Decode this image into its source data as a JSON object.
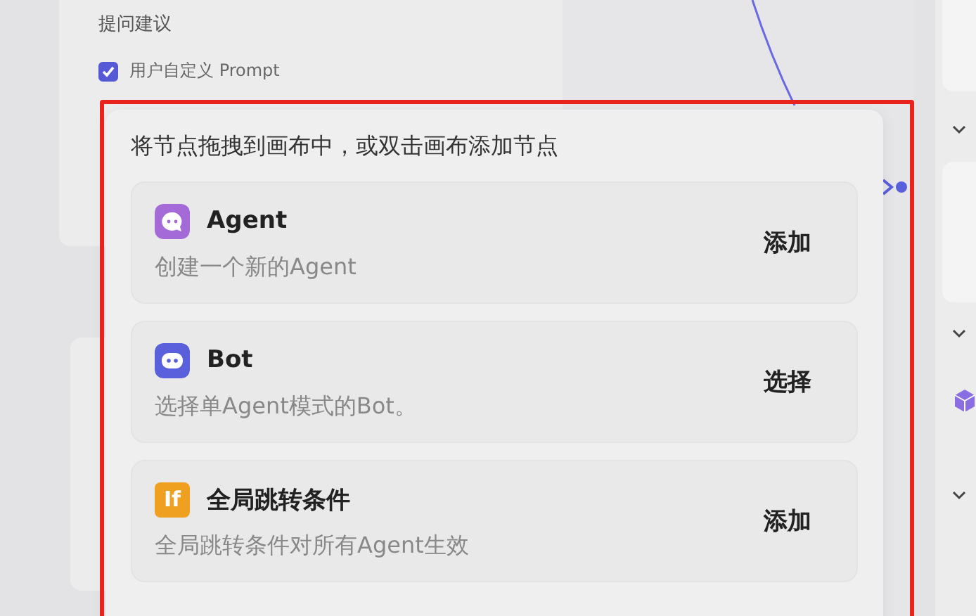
{
  "settings_card": {
    "section_label": "提问建议",
    "custom_prompt": {
      "label": "用户自定义 Prompt",
      "checked": true
    }
  },
  "node_palette": {
    "hint": "将节点拖拽到画布中，或双击画布添加节点",
    "items": [
      {
        "kind": "agent",
        "title": "Agent",
        "description": "创建一个新的Agent",
        "action": "添加"
      },
      {
        "kind": "bot",
        "title": "Bot",
        "description": "选择单Agent模式的Bot。",
        "action": "选择"
      },
      {
        "kind": "condition",
        "icon_text": "If",
        "title": "全局跳转条件",
        "description": "全局跳转条件对所有Agent生效",
        "action": "添加"
      }
    ]
  }
}
